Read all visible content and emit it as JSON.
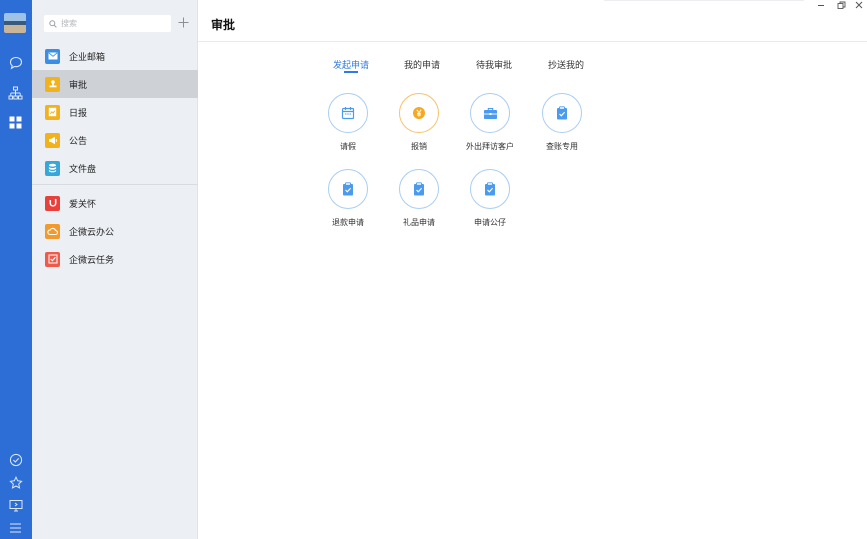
{
  "search": {
    "placeholder": "搜索"
  },
  "nav": {
    "items": [
      {
        "label": "企业邮箱",
        "color": "#3a8ee6"
      },
      {
        "label": "审批",
        "color": "#f2b21b"
      },
      {
        "label": "日报",
        "color": "#f2b21b"
      },
      {
        "label": "公告",
        "color": "#f2b21b"
      },
      {
        "label": "文件盘",
        "color": "#36a7d9"
      },
      {
        "label": "爱关怀",
        "color": "#e8413b"
      },
      {
        "label": "企微云办公",
        "color": "#f39a2c"
      },
      {
        "label": "企微云任务",
        "color": "#ef5a4a"
      }
    ]
  },
  "main": {
    "title": "审批",
    "tabs": [
      {
        "label": "发起申请"
      },
      {
        "label": "我的申请"
      },
      {
        "label": "待我审批"
      },
      {
        "label": "抄送我的"
      }
    ],
    "tiles": [
      {
        "label": "请假",
        "icon": "calendar-icon"
      },
      {
        "label": "报销",
        "icon": "yuan-coin-icon"
      },
      {
        "label": "外出拜访客户",
        "icon": "briefcase-icon"
      },
      {
        "label": "查账专用",
        "icon": "clipboard-check-icon"
      },
      {
        "label": "退款申请",
        "icon": "clipboard-check-icon"
      },
      {
        "label": "礼品申请",
        "icon": "clipboard-check-icon"
      },
      {
        "label": "申请公仔",
        "icon": "clipboard-check-icon"
      }
    ]
  },
  "colors": {
    "rail": "#2c6dd6",
    "accent": "#2f7be5",
    "active_nav": "#ced1d6"
  }
}
